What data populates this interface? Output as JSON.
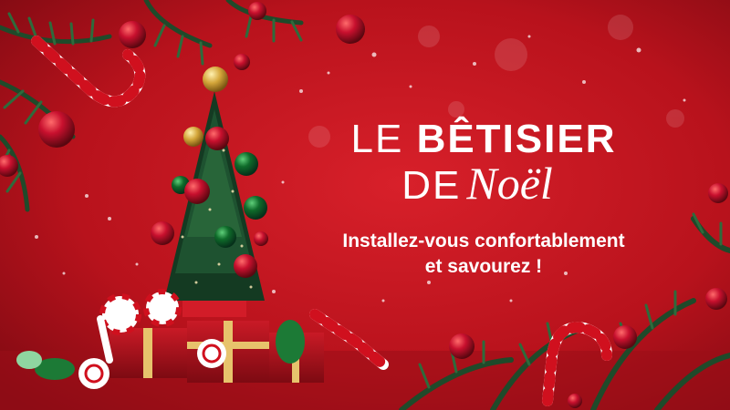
{
  "title": {
    "line1_light": "LE ",
    "line1_bold": "BÊTISIER",
    "line2_light": "DE",
    "line2_script": "Noël"
  },
  "subtitle": {
    "line1": "Installez-vous confortablement",
    "line2": "et savourez !"
  },
  "colors": {
    "background": "#b8121c",
    "text": "#ffffff",
    "ornament_red": "#c8102e",
    "ornament_green": "#0f6b2a",
    "ornament_gold": "#d4a63a",
    "pine": "#1f4a2a"
  }
}
